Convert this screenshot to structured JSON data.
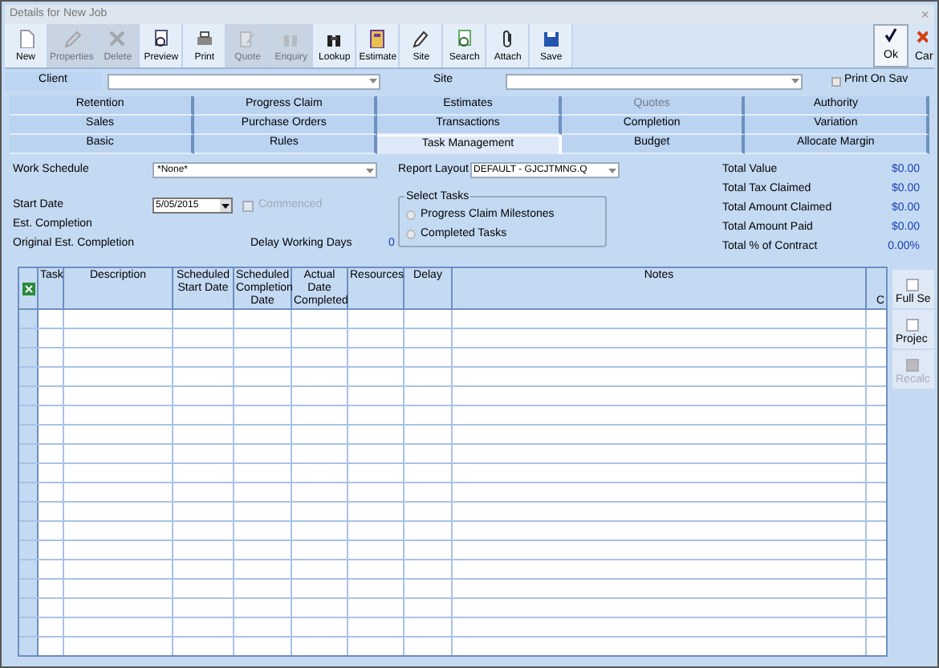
{
  "window": {
    "title": "Details for New Job",
    "close": "×"
  },
  "toolbar": [
    {
      "label": "New",
      "disabled": false
    },
    {
      "label": "Properties",
      "disabled": true
    },
    {
      "label": "Delete",
      "disabled": true
    },
    {
      "label": "Preview",
      "disabled": false
    },
    {
      "label": "Print",
      "disabled": false
    },
    {
      "label": "Quote",
      "disabled": true
    },
    {
      "label": "Enquiry",
      "disabled": true
    },
    {
      "label": "Lookup",
      "disabled": false
    },
    {
      "label": "Estimate",
      "disabled": false
    },
    {
      "label": "Site",
      "disabled": false
    },
    {
      "label": "Search",
      "disabled": false
    },
    {
      "label": "Attach",
      "disabled": false
    },
    {
      "label": "Save",
      "disabled": false
    }
  ],
  "toolbar_right": [
    {
      "label": "Ok"
    },
    {
      "label": "Car"
    }
  ],
  "client_row": {
    "client_label": "Client",
    "site_label": "Site",
    "print_on_save": {
      "label": "Print On Sav",
      "checked": false
    }
  },
  "tabs": [
    [
      {
        "label": "Retention",
        "selected": false,
        "disabled": false
      },
      {
        "label": "Progress Claim",
        "selected": false,
        "disabled": false
      },
      {
        "label": "Estimates",
        "selected": false,
        "disabled": false
      },
      {
        "label": "Quotes",
        "selected": false,
        "disabled": true
      },
      {
        "label": "Authority",
        "selected": false,
        "disabled": false
      }
    ],
    [
      {
        "label": "Sales",
        "selected": false,
        "disabled": false
      },
      {
        "label": "Purchase Orders",
        "selected": false,
        "disabled": false
      },
      {
        "label": "Transactions",
        "selected": false,
        "disabled": false
      },
      {
        "label": "Completion",
        "selected": false,
        "disabled": false
      },
      {
        "label": "Variation",
        "selected": false,
        "disabled": false
      }
    ],
    [
      {
        "label": "Basic",
        "selected": false,
        "disabled": false
      },
      {
        "label": "Rules",
        "selected": false,
        "disabled": false
      },
      {
        "label": "Task Management",
        "selected": true,
        "disabled": false
      },
      {
        "label": "Budget",
        "selected": false,
        "disabled": false
      },
      {
        "label": "Allocate Margin",
        "selected": false,
        "disabled": false
      }
    ]
  ],
  "form": {
    "work_schedule": {
      "label": "Work Schedule",
      "value": "*None*"
    },
    "report_layout": {
      "label": "Report Layout",
      "value": "DEFAULT - GJCJTMNG.Q"
    },
    "start_date": {
      "label": "Start Date",
      "value": "5/05/2015"
    },
    "commenced": {
      "label": "Commenced",
      "checked": false,
      "disabled": true
    },
    "est_completion": {
      "label": "Est. Completion"
    },
    "original_est_completion": {
      "label": "Original Est. Completion"
    },
    "delay_working_days": {
      "label": "Delay Working Days",
      "value": "0"
    },
    "select_tasks": {
      "title": "Select Tasks",
      "options": [
        {
          "label": "Progress Claim Milestones",
          "selected": false
        },
        {
          "label": "Completed Tasks",
          "selected": false
        }
      ]
    },
    "totals": [
      {
        "label": "Total Value",
        "value": "$0.00"
      },
      {
        "label": "Total Tax Claimed",
        "value": "$0.00"
      },
      {
        "label": "Total Amount Claimed",
        "value": "$0.00"
      },
      {
        "label": "Total Amount Paid",
        "value": "$0.00"
      },
      {
        "label": "Total % of Contract",
        "value": "0.00%"
      }
    ]
  },
  "table": {
    "columns": [
      "Task",
      "Description",
      "Scheduled Start Date",
      "Scheduled Completion Date",
      "Actual Date Completed",
      "Resources",
      "Delay",
      "Notes",
      "C"
    ]
  },
  "side_buttons": [
    {
      "label": "Full Se",
      "disabled": false
    },
    {
      "label": "Projec",
      "disabled": false
    },
    {
      "label": "Recalc",
      "disabled": true
    }
  ]
}
